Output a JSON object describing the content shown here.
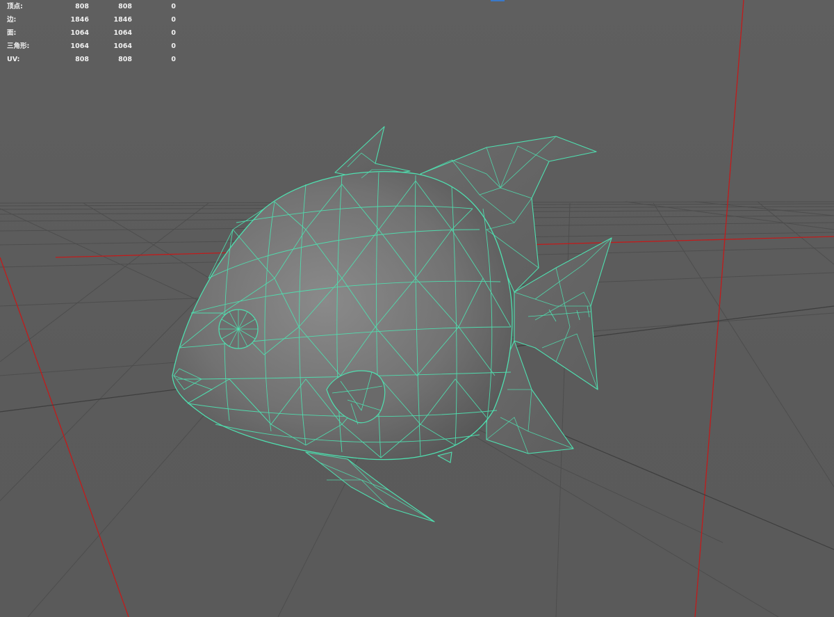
{
  "hud": {
    "rows": [
      {
        "label": "顶点:",
        "v1": "808",
        "v2": "808",
        "v3": "0"
      },
      {
        "label": "边:",
        "v1": "1846",
        "v2": "1846",
        "v3": "0"
      },
      {
        "label": "面:",
        "v1": "1064",
        "v2": "1064",
        "v3": "0"
      },
      {
        "label": "三角形:",
        "v1": "1064",
        "v2": "1064",
        "v3": "0"
      },
      {
        "label": "UV:",
        "v1": "808",
        "v2": "808",
        "v3": "0"
      }
    ]
  },
  "colors": {
    "background": "#5d5d5d",
    "grid": "#4a4a4a",
    "axis": "#c21b1b",
    "wire": "#4fe0b0",
    "mesh_fill": "#7a7a7a",
    "hud_text": "#f0f0f0"
  },
  "scene": {
    "object": "fish-mesh",
    "display_mode": "wireframe-on-shaded"
  }
}
